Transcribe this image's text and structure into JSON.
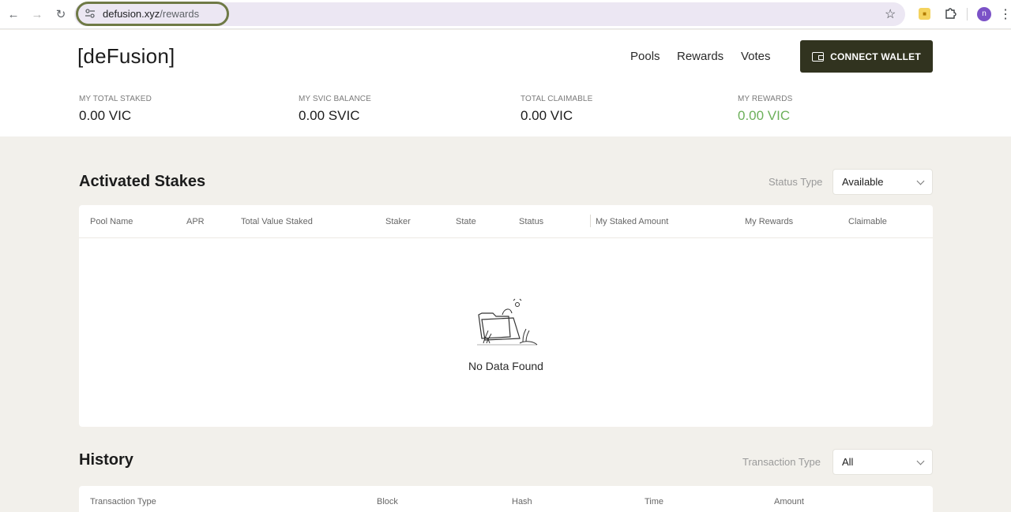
{
  "browser": {
    "url_domain": "defusion.xyz",
    "url_path": "/rewards",
    "avatar_letter": "n"
  },
  "header": {
    "logo": "[deFusion]",
    "nav": [
      "Pools",
      "Rewards",
      "Votes"
    ],
    "connect_label": "CONNECT WALLET"
  },
  "stats": [
    {
      "label": "MY TOTAL STAKED",
      "value": "0.00 VIC"
    },
    {
      "label": "MY SVIC BALANCE",
      "value": "0.00 SVIC"
    },
    {
      "label": "TOTAL CLAIMABLE",
      "value": "0.00 VIC"
    },
    {
      "label": "MY REWARDS",
      "value": "0.00 VIC"
    }
  ],
  "stakes": {
    "title": "Activated Stakes",
    "filter_label": "Status Type",
    "filter_value": "Available",
    "columns": [
      "Pool Name",
      "APR",
      "Total Value Staked",
      "Staker",
      "State",
      "Status",
      "My Staked Amount",
      "My Rewards",
      "Claimable"
    ],
    "empty_text": "No Data Found"
  },
  "history": {
    "title": "History",
    "filter_label": "Transaction Type",
    "filter_value": "All",
    "columns": [
      "Transaction Type",
      "Block",
      "Hash",
      "Time",
      "Amount"
    ]
  },
  "colors": {
    "accent_green": "#6cb05a",
    "button_dark": "#31331f",
    "page_bg": "#f2f0eb"
  }
}
